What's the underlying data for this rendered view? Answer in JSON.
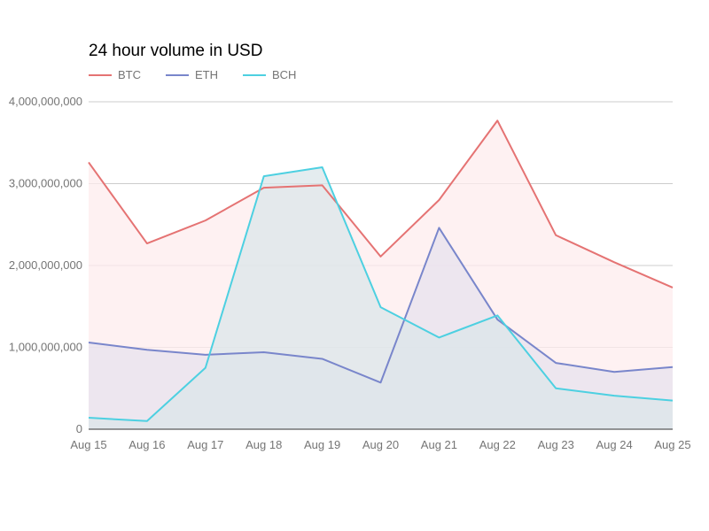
{
  "chart_data": {
    "type": "area",
    "title": "24 hour volume in USD",
    "xlabel": "",
    "ylabel": "",
    "categories": [
      "Aug 15",
      "Aug 16",
      "Aug 17",
      "Aug 18",
      "Aug 19",
      "Aug 20",
      "Aug 21",
      "Aug 22",
      "Aug 23",
      "Aug 24",
      "Aug 25"
    ],
    "series": [
      {
        "name": "BTC",
        "color": "#e57373",
        "fill": "#fdeced",
        "values": [
          3260000000,
          2270000000,
          2550000000,
          2950000000,
          2980000000,
          2110000000,
          2800000000,
          3770000000,
          2370000000,
          2040000000,
          1730000000
        ]
      },
      {
        "name": "ETH",
        "color": "#7986cb",
        "fill": "#e7e2ee",
        "values": [
          1060000000,
          970000000,
          910000000,
          940000000,
          860000000,
          570000000,
          2460000000,
          1340000000,
          810000000,
          700000000,
          760000000
        ]
      },
      {
        "name": "BCH",
        "color": "#4dd0e1",
        "fill": "#dbe5ea",
        "values": [
          140000000,
          100000000,
          750000000,
          3090000000,
          3200000000,
          1490000000,
          1120000000,
          1390000000,
          500000000,
          410000000,
          350000000
        ]
      }
    ],
    "ylim": [
      0,
      4000000000
    ],
    "yticks": [
      0,
      1000000000,
      2000000000,
      3000000000,
      4000000000
    ],
    "ytick_labels": [
      "0",
      "1,000,000,000",
      "2,000,000,000",
      "3,000,000,000",
      "4,000,000,000"
    ],
    "grid": true,
    "legend_position": "top-left"
  }
}
